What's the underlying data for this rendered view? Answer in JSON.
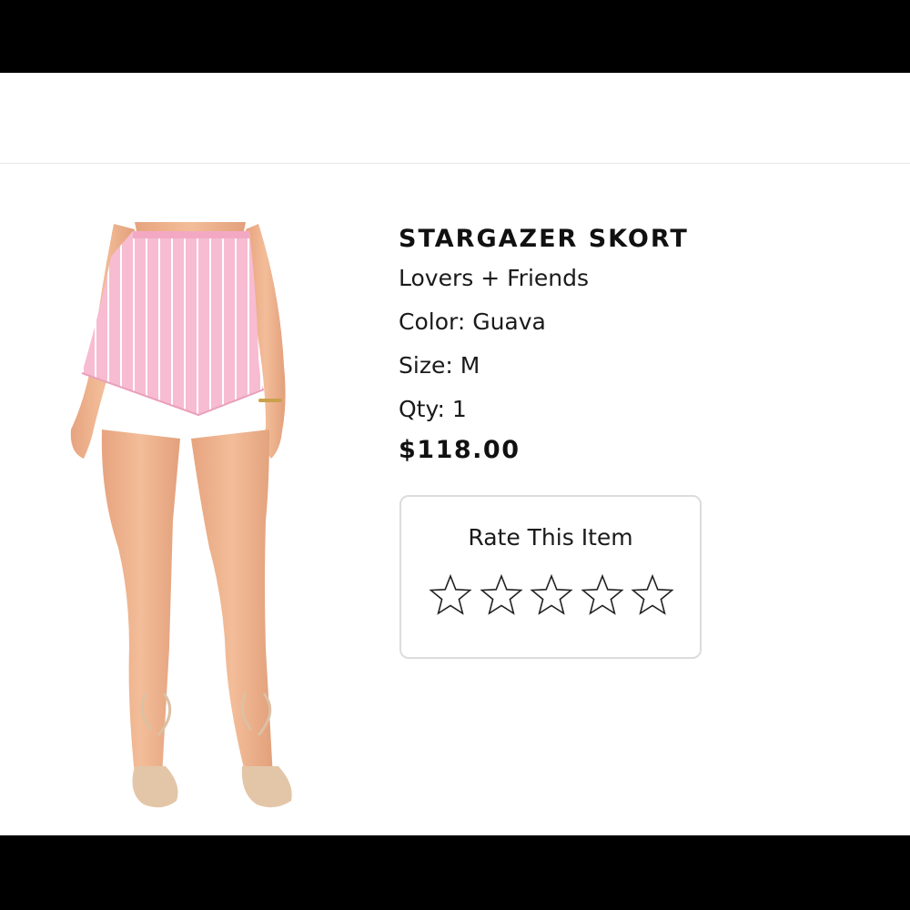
{
  "product": {
    "name": "STARGAZER SKORT",
    "brand": "Lovers + Friends",
    "color": "Color: Guava",
    "size": "Size: M",
    "qty": "Qty: 1",
    "price": "$118.00"
  },
  "rating": {
    "title": "Rate This Item",
    "max_stars": 5,
    "current_rating": 0,
    "star_icon": "star-outline-icon"
  },
  "image": {
    "subject": "product-photo-pink-striped-skort",
    "skirt_color": "#f6b9cf",
    "stripe_color": "#ffffff",
    "skin_color": "#efb28e",
    "sandal_color": "#e0c3a6"
  }
}
